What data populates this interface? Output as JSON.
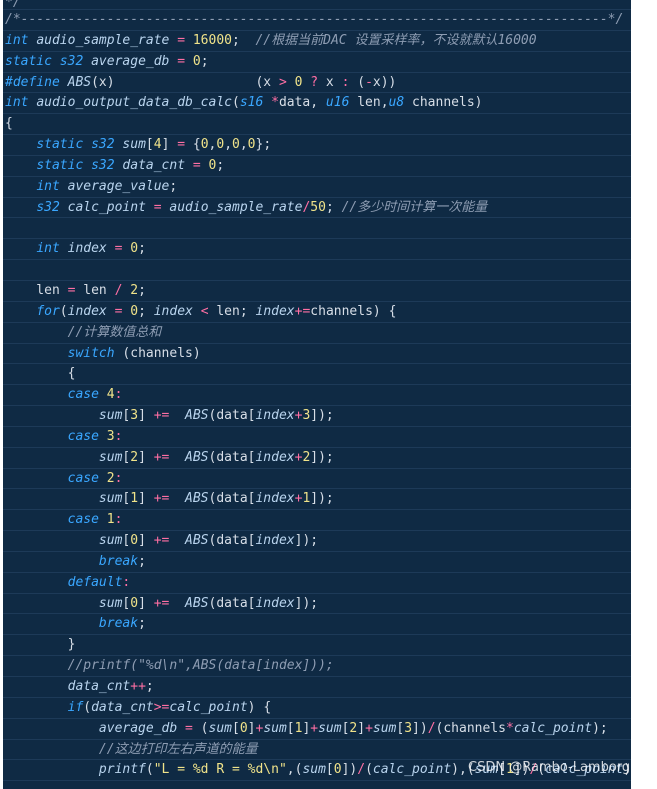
{
  "editor": {
    "lines": [
      "*/",
      "/*---------------------------------------------------------------------------*/",
      "int audio_sample_rate = 16000;  //根据当前DAC 设置采样率，不设就默认16000",
      "static s32 average_db = 0;",
      "#define ABS(x)                  (x > 0 ? x : (-x))",
      "int audio_output_data_db_calc(s16 *data, u16 len,u8 channels)",
      "{",
      "    static s32 sum[4] = {0,0,0,0};",
      "    static s32 data_cnt = 0;",
      "    int average_value;",
      "    s32 calc_point = audio_sample_rate/50; //多少时间计算一次能量",
      "",
      "    int index = 0;",
      "",
      "    len = len / 2;",
      "    for(index = 0; index < len; index+=channels) {",
      "        //计算数值总和",
      "        switch (channels)",
      "        {",
      "        case 4:",
      "            sum[3] +=  ABS(data[index+3]);",
      "        case 3:",
      "            sum[2] +=  ABS(data[index+2]);",
      "        case 2:",
      "            sum[1] +=  ABS(data[index+1]);",
      "        case 1:",
      "            sum[0] +=  ABS(data[index]);",
      "            break;",
      "        default:",
      "            sum[0] +=  ABS(data[index]);",
      "            break;",
      "        }",
      "        //printf(\"%d\\n\",ABS(data[index]));",
      "        data_cnt++;",
      "        if(data_cnt>=calc_point) {",
      "            average_db = (sum[0]+sum[1]+sum[2]+sum[3])/(channels*calc_point);",
      "            //这边打印左右声道的能量",
      "            printf(\"L = %d R = %d\\n\",(sum[0])/(calc_point),(sum[1])/(calc_point));"
    ]
  },
  "watermark": "CSDN @Rambo-Lamborghini",
  "colors": {
    "background": "#0f2a44",
    "keyword": "#3aa7ff",
    "number": "#f0e38a",
    "operator": "#ff6fa4",
    "comment": "#8e9db3"
  }
}
